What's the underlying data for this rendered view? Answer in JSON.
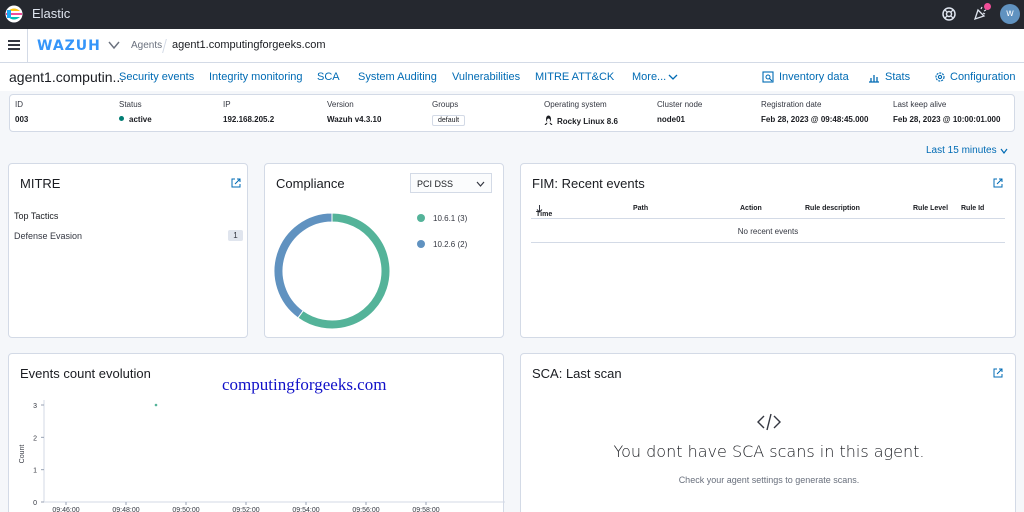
{
  "topbar": {
    "title": "Elastic",
    "avatar_letter": "w"
  },
  "navbar": {
    "brand": "WAZUH",
    "crumb_agents": "Agents",
    "crumb_host": "agent1.computingforgeeks.com"
  },
  "tabs": {
    "agent_name": "agent1.computin...",
    "items": [
      "Security events",
      "Integrity monitoring",
      "SCA",
      "System Auditing",
      "Vulnerabilities",
      "MITRE ATT&CK",
      "More..."
    ],
    "right": {
      "inventory": "Inventory data",
      "stats": "Stats",
      "configuration": "Configuration"
    }
  },
  "agent": {
    "labels": {
      "id": "ID",
      "status": "Status",
      "ip": "IP",
      "version": "Version",
      "groups": "Groups",
      "os": "Operating system",
      "cluster": "Cluster node",
      "registration": "Registration date",
      "keepalive": "Last keep alive"
    },
    "id": "003",
    "status": "active",
    "ip": "192.168.205.2",
    "version": "Wazuh v4.3.10",
    "group": "default",
    "os": "Rocky Linux 8.6",
    "cluster": "node01",
    "registration": "Feb 28, 2023 @ 09:48:45.000",
    "keepalive": "Feb 28, 2023 @ 10:00:01.000"
  },
  "time_range": "Last 15 minutes",
  "mitre": {
    "title": "MITRE",
    "subtitle": "Top Tactics",
    "tactic": "Defense Evasion",
    "count": "1"
  },
  "compliance": {
    "title": "Compliance",
    "selected": "PCI DSS",
    "legend": [
      {
        "label": "10.6.1 (3)",
        "color": "#54b399"
      },
      {
        "label": "10.2.6 (2)",
        "color": "#6092c0"
      }
    ]
  },
  "chart_data": {
    "type": "pie",
    "categories": [
      "10.6.1",
      "10.2.6"
    ],
    "values": [
      3,
      2
    ],
    "colors": [
      "#54b399",
      "#6092c0"
    ]
  },
  "fim": {
    "title": "FIM: Recent events",
    "columns": [
      "Time",
      "Path",
      "Action",
      "Rule description",
      "Rule Level",
      "Rule Id"
    ],
    "empty": "No recent events"
  },
  "events": {
    "title": "Events count evolution",
    "watermark": "computingforgeeks.com",
    "ylabel": "Count",
    "y_ticks": [
      "0",
      "1",
      "2",
      "3"
    ],
    "x_ticks": [
      "09:46:00",
      "09:48:00",
      "09:50:00",
      "09:52:00",
      "09:54:00",
      "09:56:00",
      "09:58:00"
    ],
    "point": {
      "x": "09:49:00",
      "y": 3
    }
  },
  "sca": {
    "title": "SCA: Last scan",
    "message": "You dont have SCA scans in this agent.",
    "hint": "Check your agent settings to generate scans."
  }
}
